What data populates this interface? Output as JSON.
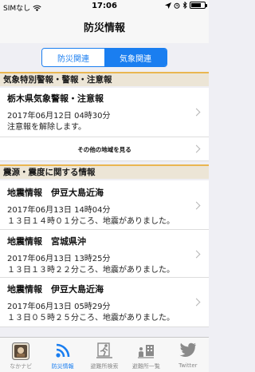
{
  "status_bar": {
    "carrier": "SIMなし",
    "time": "17:06"
  },
  "nav": {
    "title": "防災情報"
  },
  "segments": [
    {
      "label": "防災関連",
      "active": false
    },
    {
      "label": "気象関連",
      "active": true
    }
  ],
  "warnings_section": {
    "header": "気象特別警報・警報・注意報",
    "items": [
      {
        "title": "栃木県気象警報・注意報",
        "date": "2017年06月12日 04時30分",
        "detail": "注意報を解除します。"
      }
    ],
    "more_link": "その他の地域を見る"
  },
  "quake_section": {
    "header": "震源・震度に関する情報",
    "items": [
      {
        "title": "地震情報　伊豆大島近海",
        "date": "2017年06月13日 14時04分",
        "detail": "１３日１４時０１分ころ、地震がありました。"
      },
      {
        "title": "地震情報　宮城県沖",
        "date": "2017年06月13日 13時25分",
        "detail": "１３日１３時２２分ころ、地震がありました。"
      },
      {
        "title": "地震情報　伊豆大島近海",
        "date": "2017年06月13日 05時29分",
        "detail": "１３日０５時２５分ころ、地震がありました。"
      }
    ]
  },
  "tab_bar": {
    "tabs": [
      {
        "label": "なかナビ",
        "icon": "app-logo-icon",
        "active": false
      },
      {
        "label": "防災情報",
        "icon": "broadcast-icon",
        "active": true
      },
      {
        "label": "避難所検索",
        "icon": "evacuation-icon",
        "active": false
      },
      {
        "label": "避難所一覧",
        "icon": "shelter-list-icon",
        "active": false
      },
      {
        "label": "Twitter",
        "icon": "twitter-bird-icon",
        "active": false
      }
    ]
  },
  "colors": {
    "accent": "#1a7ef0",
    "section_border": "#e9b651",
    "section_bg": "#ece5d6"
  }
}
